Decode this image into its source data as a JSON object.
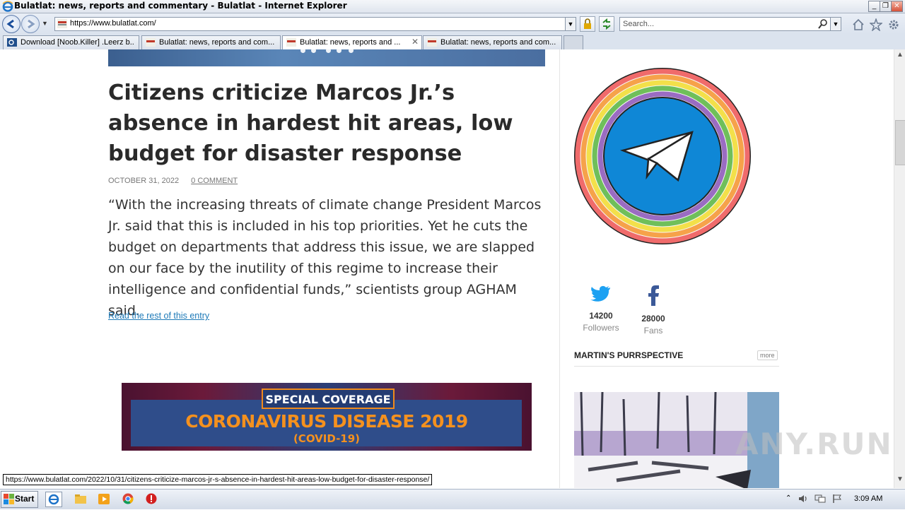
{
  "window": {
    "title": "Bulatlat: news, reports and commentary - Bulatlat - Internet Explorer",
    "controls": [
      "_",
      "❐",
      "✕"
    ]
  },
  "address_bar": {
    "url": "https://www.bulatlat.com/",
    "search_placeholder": "Search..."
  },
  "tabs": [
    {
      "label": "Download [Noob.Killer] .Leerz b...",
      "active": false
    },
    {
      "label": "Bulatlat: news, reports and com...",
      "active": false
    },
    {
      "label": "Bulatlat: news, reports and ...",
      "active": true,
      "close": "✕"
    },
    {
      "label": "Bulatlat: news, reports and com...",
      "active": false
    }
  ],
  "article": {
    "headline": "Citizens criticize Marcos Jr.’s absence in hardest hit areas, low budget for disaster response",
    "date": "OCTOBER 31, 2022",
    "comments": "0 COMMENT",
    "excerpt": "“With the increasing threats of climate change President Marcos Jr. said that this is included in his top priorities. Yet he cuts the budget on departments that address this issue, we are slapped on our face by the inutility of this regime to increase their intelligence and confidential funds,” scientists group AGHAM said.",
    "read_more": "Read the rest of this entry"
  },
  "banner": {
    "tag": "SPECIAL COVERAGE",
    "title": "CORONAVIRUS DISEASE 2019",
    "subtitle": "(COVID-19)"
  },
  "sidebar": {
    "twitter": {
      "count": "14200",
      "label": "Followers",
      "icon": "twitter-icon",
      "color": "#1da1f2"
    },
    "facebook": {
      "count": "28000",
      "label": "Fans",
      "icon": "facebook-icon",
      "color": "#3b5998"
    },
    "section_title": "MARTIN'S PURRSPECTIVE",
    "more": "more"
  },
  "status_url": "https://www.bulatlat.com/2022/10/31/citizens-criticize-marcos-jr-s-absence-in-hardest-hit-areas-low-budget-for-disaster-response/",
  "watermark": "ANY.RUN",
  "taskbar": {
    "start": "Start",
    "clock": "3:09 AM"
  }
}
